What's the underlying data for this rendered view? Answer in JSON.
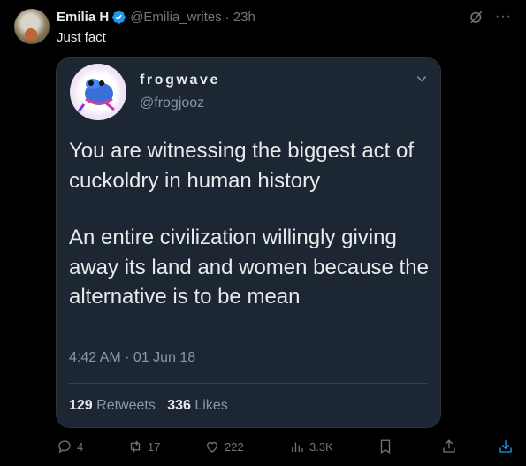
{
  "post": {
    "author_name": "Emilia H",
    "author_handle": "@Emilia_writes",
    "separator": "·",
    "time": "23h",
    "text": "Just fact"
  },
  "quoted": {
    "name": "frogwave",
    "handle": "@frogjooz",
    "paragraph1": "You are witnessing the biggest act of cuckoldry in human history",
    "paragraph2": "An entire civilization willingly giving away its land and women because the alternative is to be mean",
    "timestamp": "4:42 AM · 01 Jun 18",
    "retweets_count": "129",
    "retweets_label": "Retweets",
    "likes_count": "336",
    "likes_label": "Likes"
  },
  "actions": {
    "replies": "4",
    "reposts": "17",
    "likes": "222",
    "views": "3.3K"
  },
  "icons": {
    "verified": "verified-badge-icon",
    "grok": "grok-icon",
    "more": "more-icon",
    "chevron": "chevron-down-icon",
    "reply": "reply-icon",
    "repost": "repost-icon",
    "like": "heart-icon",
    "views": "views-icon",
    "bookmark": "bookmark-icon",
    "share": "share-icon",
    "download": "download-icon"
  },
  "colors": {
    "background": "#000000",
    "text": "#e7e9ea",
    "muted": "#71767b",
    "verified": "#1d9bf0",
    "quote_bg": "#1c2733",
    "download_accent": "#1d9bf0"
  }
}
